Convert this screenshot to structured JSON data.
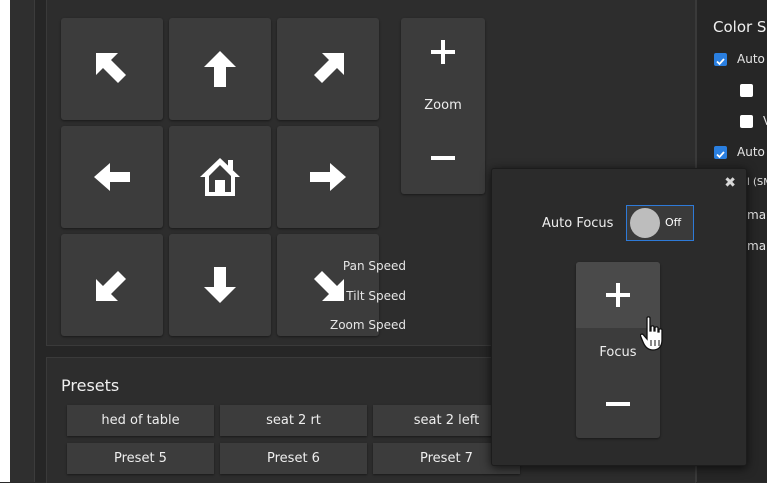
{
  "ptz": {
    "zoom_label": "Zoom",
    "pan_speed_label": "Pan Speed",
    "tilt_speed_label": "Tilt Speed",
    "zoom_speed_label": "Zoom Speed"
  },
  "color_settings": {
    "title": "Color S",
    "items": [
      {
        "label": "Auto",
        "checked": true
      },
      {
        "label": "",
        "checked": false
      },
      {
        "label": "V",
        "checked": false
      },
      {
        "label": "Auto",
        "checked": true
      }
    ],
    "partial_labels": [
      "l (SM",
      "ma",
      "ma"
    ]
  },
  "presets": {
    "title": "Presets",
    "buttons": [
      "hed of table",
      "seat 2 rt",
      "seat 2 left",
      "Preset 5",
      "Preset 6",
      "Preset 7"
    ]
  },
  "focus_popup": {
    "close_glyph": "✖",
    "auto_focus_label": "Auto Focus",
    "auto_focus_state": "Off",
    "focus_label": "Focus"
  },
  "colors": {
    "accent": "#2a7fe0",
    "button": "#3c3c3c",
    "panel": "#2d2d2d"
  }
}
